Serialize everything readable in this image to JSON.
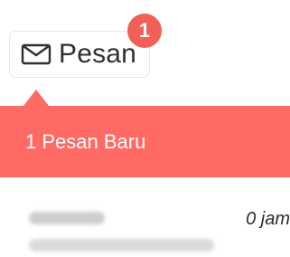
{
  "message_button": {
    "icon": "envelope-icon",
    "label": "Pesan",
    "badge_count": "1"
  },
  "dropdown": {
    "title": "1 Pesan Baru",
    "header_color": "#ff6a64"
  },
  "notifications": [
    {
      "time": "0 jam"
    }
  ],
  "colors": {
    "badge": "#f25f57",
    "header": "#ff6a64"
  }
}
